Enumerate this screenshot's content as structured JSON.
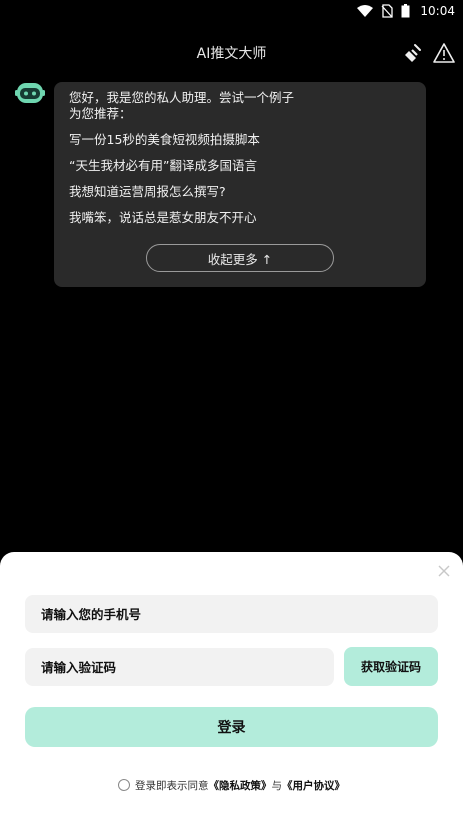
{
  "status_bar": {
    "time": "10:04",
    "icons": [
      "wifi-icon",
      "no-sim-icon",
      "battery-icon"
    ]
  },
  "header": {
    "title": "AI推文大师",
    "right_icons": [
      "broom-icon",
      "warning-icon"
    ]
  },
  "chat": {
    "intro_line1": "您好，我是您的私人助理。尝试一个例子",
    "intro_line2": "为您推荐：",
    "examples": [
      "写一份15秒的美食短视频拍摄脚本",
      "“天生我材必有用”翻译成多国语言",
      "我想知道运营周报怎么撰写?",
      "我嘴笨，说话总是惹女朋友不开心"
    ],
    "collapse_label": "收起更多 ↑"
  },
  "login_sheet": {
    "phone_placeholder": "请输入您的手机号",
    "code_placeholder": "请输入验证码",
    "get_code_label": "获取验证码",
    "login_label": "登录",
    "agree_text": "登录即表示同意",
    "privacy_link": "《隐私政策》",
    "and_text": "与",
    "terms_link": "《用户协议》"
  },
  "colors": {
    "background": "#000000",
    "bubble": "#2a2a2a",
    "accent": "#b3ecdb",
    "sheet": "#ffffff"
  }
}
